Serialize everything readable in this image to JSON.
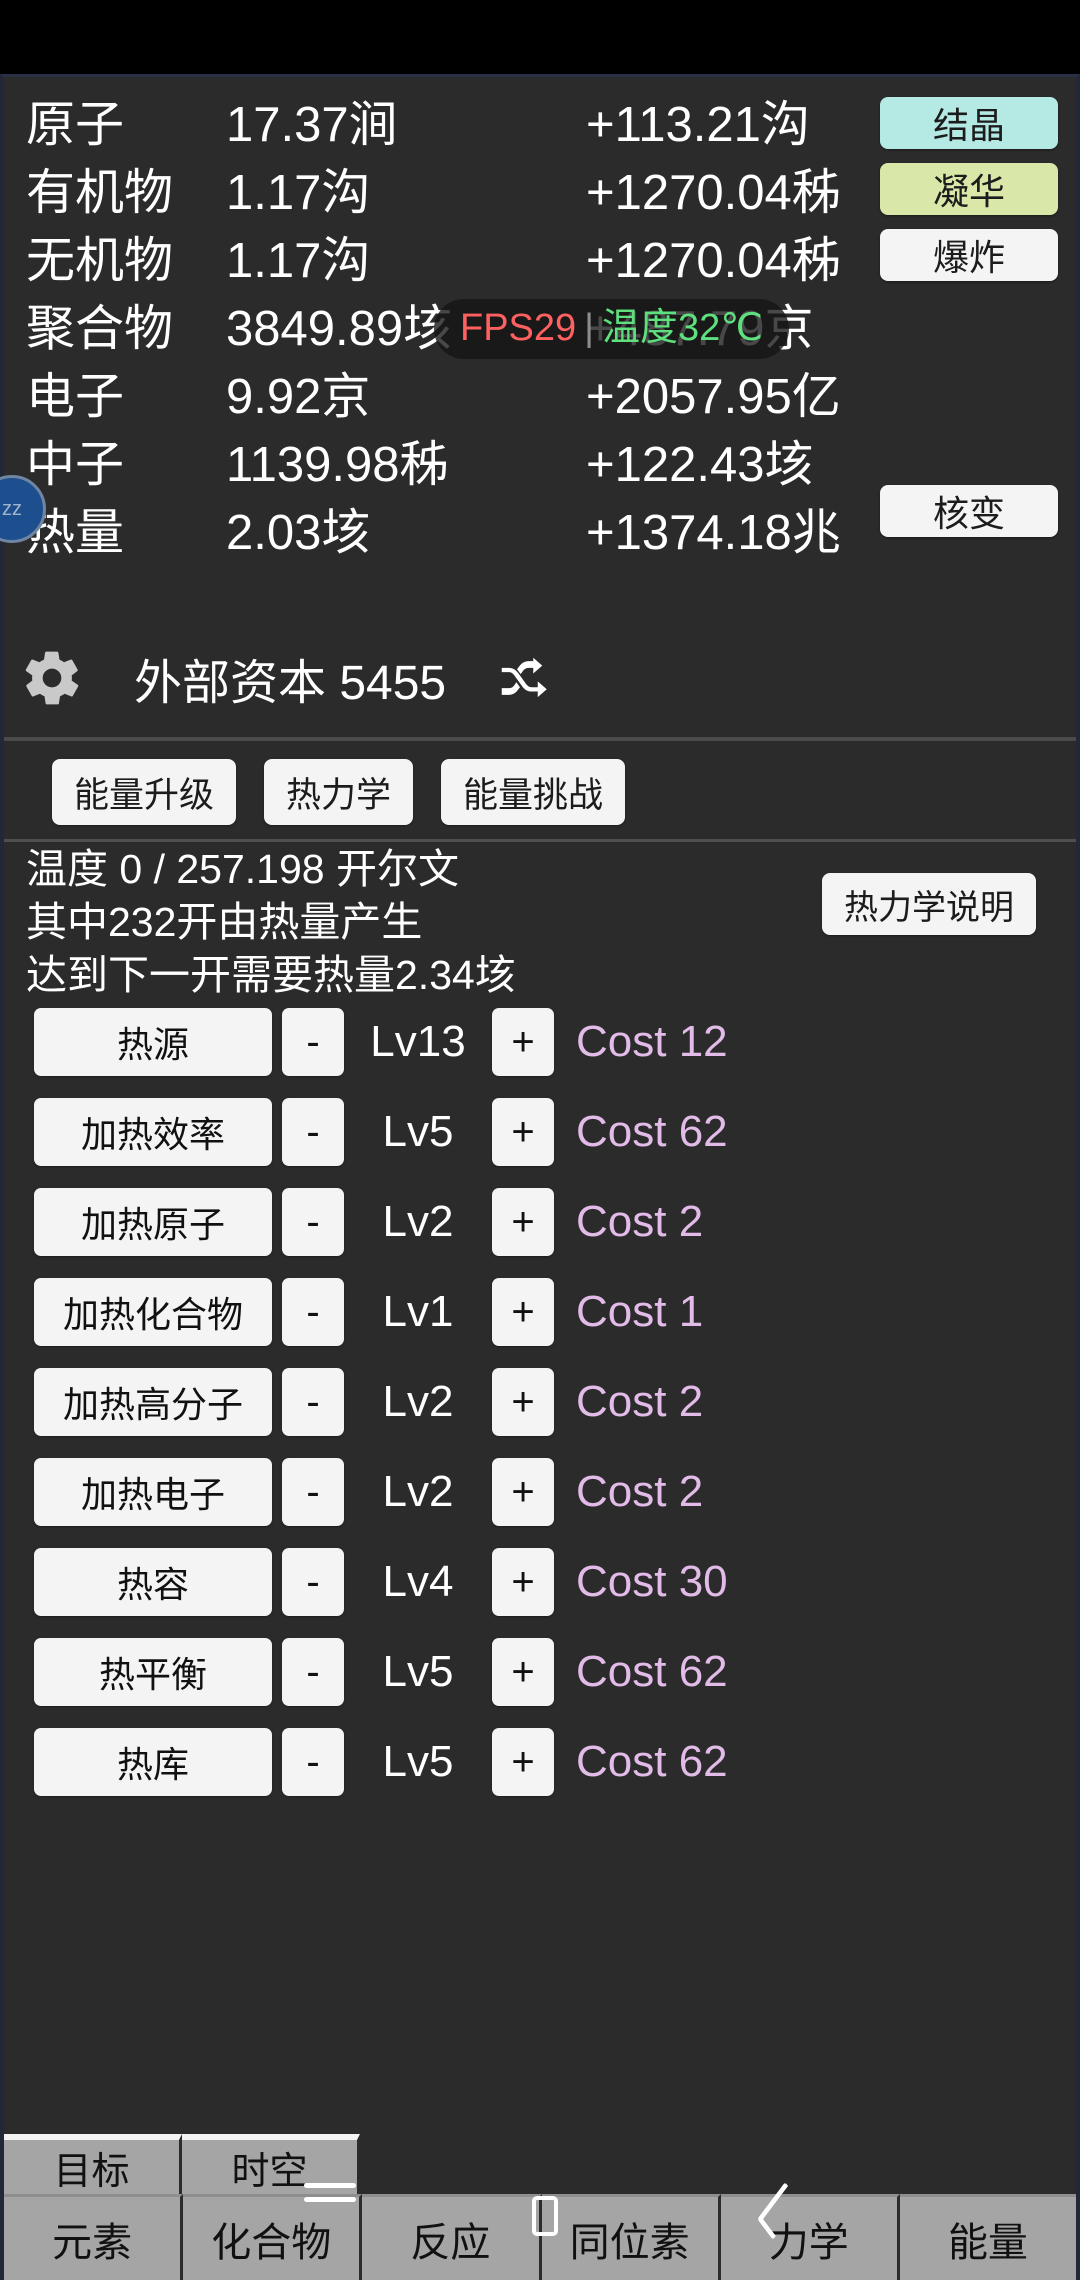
{
  "app": {
    "resources": [
      {
        "name": "原子",
        "amount": "17.37涧",
        "rate": "+113.21沟"
      },
      {
        "name": "有机物",
        "amount": "1.17沟",
        "rate": "+1270.04秭"
      },
      {
        "name": "无机物",
        "amount": "1.17沟",
        "rate": "+1270.04秭"
      },
      {
        "name": "聚合物",
        "amount": "3849.89垓",
        "rate": "+487.79京"
      },
      {
        "name": "电子",
        "amount": "9.92京",
        "rate": "+2057.95亿"
      },
      {
        "name": "中子",
        "amount": "1139.98秭",
        "rate": "+122.43垓"
      },
      {
        "name": "热量",
        "amount": "2.03垓",
        "rate": "+1374.18兆"
      }
    ],
    "overlay": {
      "fps": "FPS29",
      "separator": "|",
      "temperature": "温度32℃",
      "fps_color": "#ff6161",
      "temp_color": "#5fe07f"
    },
    "side_buttons": [
      {
        "label": "结晶",
        "color": "#b5e9e4"
      },
      {
        "label": "凝华",
        "color": "#d9e8a8"
      },
      {
        "label": "爆炸",
        "color": "#f4f4f4"
      }
    ],
    "nuclear_button": {
      "label": "核变",
      "color": "#f4f4f4"
    },
    "left_badge": {
      "label": "zz"
    },
    "capital": {
      "gear_icon": "gear-icon",
      "label": "外部资本 5455",
      "shuffle_icon": "shuffle-icon"
    },
    "tabs": [
      {
        "label": "能量升级"
      },
      {
        "label": "热力学"
      },
      {
        "label": "能量挑战"
      }
    ],
    "info": {
      "line1": "温度 0 / 257.198 开尔文",
      "line2": "其中232开由热量产生",
      "line3": "达到下一开需要热量2.34垓"
    },
    "help_button": {
      "label": "热力学说明"
    },
    "upgrade_controls": {
      "minus": "-",
      "plus": "+"
    },
    "upgrades": [
      {
        "name": "热源",
        "level": "Lv13",
        "cost": "Cost 12"
      },
      {
        "name": "加热效率",
        "level": "Lv5",
        "cost": "Cost 62"
      },
      {
        "name": "加热原子",
        "level": "Lv2",
        "cost": "Cost 2"
      },
      {
        "name": "加热化合物",
        "level": "Lv1",
        "cost": "Cost 1"
      },
      {
        "name": "加热高分子",
        "level": "Lv2",
        "cost": "Cost 2"
      },
      {
        "name": "加热电子",
        "level": "Lv2",
        "cost": "Cost 2"
      },
      {
        "name": "热容",
        "level": "Lv4",
        "cost": "Cost 30"
      },
      {
        "name": "热平衡",
        "level": "Lv5",
        "cost": "Cost 62"
      },
      {
        "name": "热库",
        "level": "Lv5",
        "cost": "Cost 62"
      }
    ],
    "nav_upper": [
      {
        "label": "目标"
      },
      {
        "label": "时空"
      }
    ],
    "nav_lower": [
      {
        "label": "元素"
      },
      {
        "label": "化合物"
      },
      {
        "label": "反应"
      },
      {
        "label": "同位素"
      },
      {
        "label": "力学"
      },
      {
        "label": "能量"
      }
    ],
    "colors": {
      "background": "#2b2b2b",
      "cost_text": "#e2bbe8",
      "button_face": "#f4f4f4",
      "nav_face": "#a5a5a5"
    }
  }
}
